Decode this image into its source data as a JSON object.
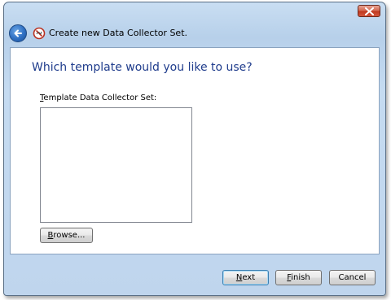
{
  "window": {
    "title": "Create new Data Collector Set."
  },
  "page": {
    "heading": "Which template would you like to use?",
    "template_label": "Template Data Collector Set:",
    "template_label_mnemonic": "T",
    "template_label_rest": "emplate Data Collector Set:",
    "template_items": [],
    "browse_label": "Browse...",
    "browse_mnemonic": "B",
    "browse_rest": "rowse..."
  },
  "footer": {
    "next_label": "Next",
    "next_mnemonic": "N",
    "next_rest": "ext",
    "finish_label": "Finish",
    "finish_mnemonic": "F",
    "finish_rest": "inish",
    "cancel_label": "Cancel"
  },
  "icons": {
    "close": "close-icon",
    "back": "back-arrow-icon",
    "app": "performance-monitor-icon"
  },
  "colors": {
    "heading": "#1f3c8c",
    "close_button": "#c0391f",
    "frame": "#bfd5ed"
  }
}
